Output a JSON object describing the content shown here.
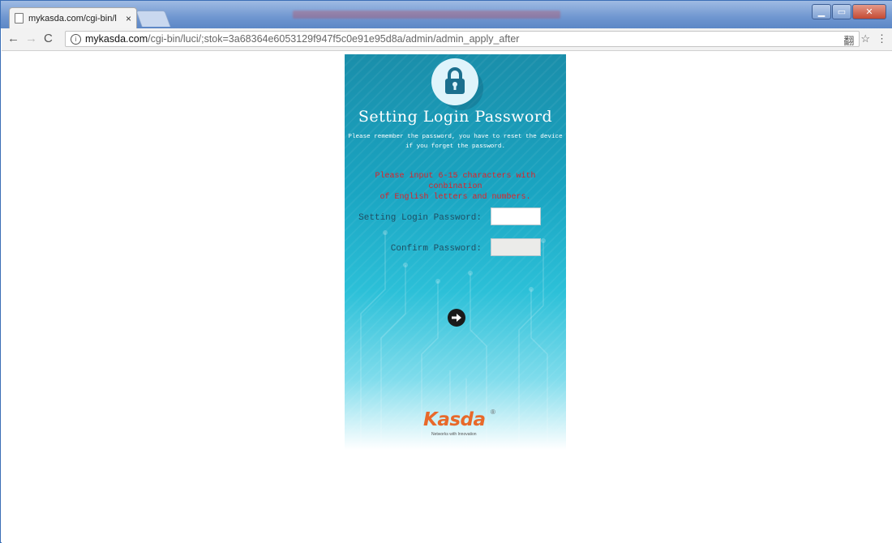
{
  "browser": {
    "tab_title": "mykasda.com/cgi-bin/l",
    "tab_close": "×",
    "url_host": "mykasda.com",
    "url_path": "/cgi-bin/luci/;stok=3a68364e6053129f947f5c0e91e95d8a/admin/admin_apply_after",
    "nav_back": "←",
    "nav_forward": "→",
    "nav_reload": "C",
    "info_glyph": "i",
    "translate_icon": "翻",
    "star_icon": "☆",
    "menu_icon": "⋮",
    "window_controls": {
      "min": "▁",
      "max": "▭",
      "close": "✕"
    }
  },
  "login": {
    "title": "Setting Login Password",
    "note_line1": "Please remember the password, you have to reset the device",
    "note_line2": "if you forget the password.",
    "warning_line1": "Please input 6-15 characters with conbination",
    "warning_line2": "of English letters and numbers.",
    "password_label": "Setting Login Password:",
    "password_value": "",
    "confirm_label": "Confirm Password:",
    "confirm_value": "",
    "brand": "Kasda",
    "brand_registered": "®",
    "brand_tagline": "Networks with Innovation"
  },
  "colors": {
    "panel_top": "#1a8eaa",
    "panel_mid": "#2cc0d8",
    "warning": "#e31e24",
    "brand": "#e8692a",
    "titlebar": "#6f96d0"
  },
  "icons": [
    "page-icon",
    "lock-icon",
    "arrow-right-icon",
    "info-icon",
    "translate-icon",
    "star-icon",
    "menu-icon"
  ]
}
